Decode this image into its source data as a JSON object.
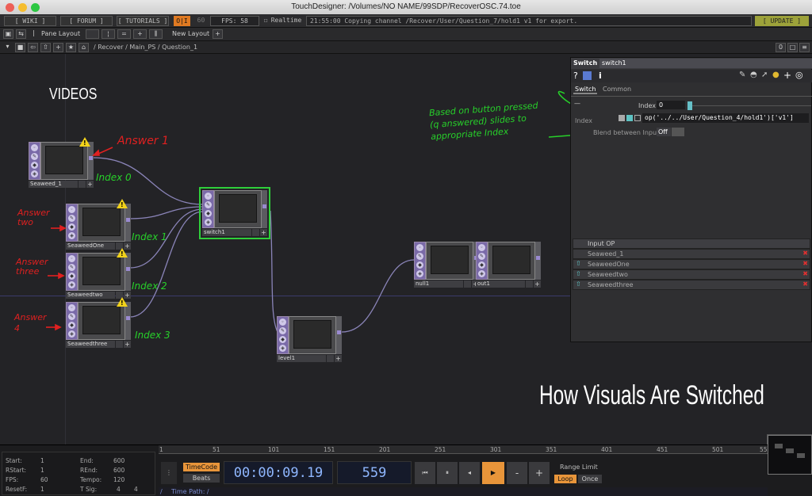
{
  "window": {
    "title": "TouchDesigner: /Volumes/NO NAME/99SDP/RecoverOSC.74.toe"
  },
  "menubar": {
    "wiki": "[ WIKI ]",
    "forum": "[ FORUM ]",
    "tutorials": "[ TUTORIALS ]",
    "oi": "O|I",
    "sixty": "60",
    "fps": "FPS: 58",
    "realtime": "Realtime",
    "status": "21:55:00 Copying channel /Recover/User/Question_7/hold1 v1 for export.",
    "update": "[ UPDATE ]"
  },
  "panebar": {
    "pane_layout": "Pane Layout",
    "new_layout": "New Layout",
    "plus": "+"
  },
  "pathbar": {
    "path": "/ Recover / Main_PS / Question_1",
    "zero": "0"
  },
  "network": {
    "videos_label": "VIDEOS",
    "caption": "How Visuals Are Switched",
    "nodes": {
      "seaweed_1": "Seaweed_1",
      "seaweedone": "SeaweedOne",
      "seaweedtwo": "Seaweedtwo",
      "seaweedthree": "Seaweedthree",
      "switch1": "switch1",
      "level1": "level1",
      "null1": "null1",
      "out1": "out1"
    },
    "annotations": {
      "answer1": "Answer 1",
      "answer2": "Answer two",
      "answer3": "Answer three",
      "answer4": "Answer 4",
      "index0": "Index 0",
      "index1": "Index 1",
      "index2": "Index 2",
      "index3": "Index 3",
      "note": "Based on button pressed (q answered) slides to appropriate Index"
    }
  },
  "params": {
    "op_type": "Switch",
    "op_name": "switch1",
    "tab_switch": "Switch",
    "tab_common": "Common",
    "index_label": "Index",
    "index_value": "0",
    "index_expr_label": "Index",
    "index_expr": "op('../../User/Question_4/hold1')['v1']",
    "blend_label": "Blend between Inputs",
    "blend_value": "Off",
    "input_header": "Input OP",
    "inputs": [
      "Seaweed_1",
      "SeaweedOne",
      "Seaweedtwo",
      "Seaweedthree"
    ]
  },
  "timeline": {
    "start_label": "Start:",
    "start": "1",
    "end_label": "End:",
    "end": "600",
    "rstart_label": "RStart:",
    "rstart": "1",
    "rend_label": "REnd:",
    "rend": "600",
    "fps_label": "FPS:",
    "fps": "60",
    "tempo_label": "Tempo:",
    "tempo": "120",
    "resetf_label": "ResetF:",
    "resetf": "1",
    "tsig_label": "T Sig:",
    "tsig1": "4",
    "tsig2": "4",
    "timecode_btn": "TimeCode",
    "beats_btn": "Beats",
    "timecode": "00:00:09.19",
    "frame": "559",
    "range_limit": "Range Limit",
    "loop": "Loop",
    "once": "Once",
    "time_path": "Time Path: /",
    "ruler": [
      "1",
      "51",
      "101",
      "151",
      "201",
      "251",
      "301",
      "351",
      "401",
      "451",
      "501",
      "55"
    ],
    "colors": {
      "accent": "#e8953a",
      "timecode_fg": "#8fb7ff"
    }
  }
}
